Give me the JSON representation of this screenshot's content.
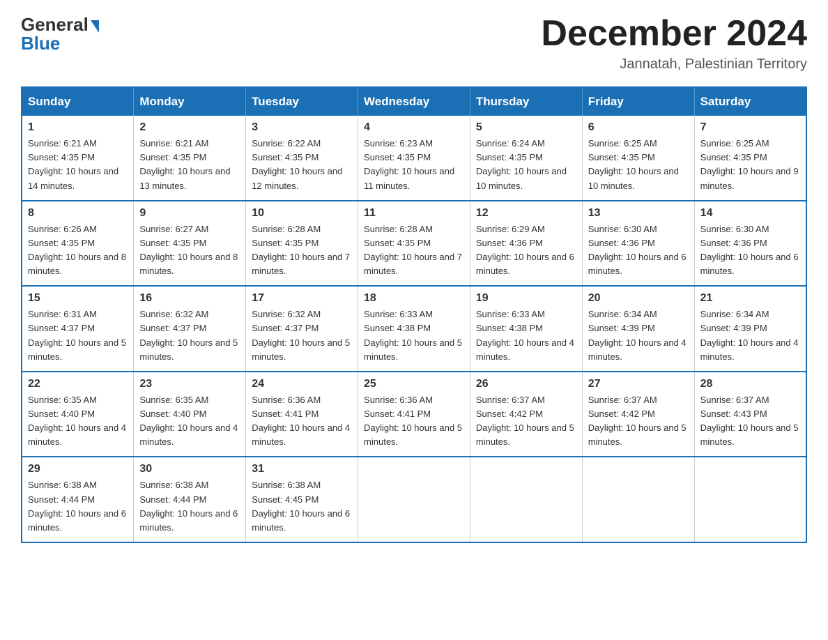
{
  "logo": {
    "general": "General",
    "blue": "Blue"
  },
  "header": {
    "month": "December 2024",
    "location": "Jannatah, Palestinian Territory"
  },
  "days_of_week": [
    "Sunday",
    "Monday",
    "Tuesday",
    "Wednesday",
    "Thursday",
    "Friday",
    "Saturday"
  ],
  "weeks": [
    [
      {
        "day": "1",
        "sunrise": "6:21 AM",
        "sunset": "4:35 PM",
        "daylight": "10 hours and 14 minutes."
      },
      {
        "day": "2",
        "sunrise": "6:21 AM",
        "sunset": "4:35 PM",
        "daylight": "10 hours and 13 minutes."
      },
      {
        "day": "3",
        "sunrise": "6:22 AM",
        "sunset": "4:35 PM",
        "daylight": "10 hours and 12 minutes."
      },
      {
        "day": "4",
        "sunrise": "6:23 AM",
        "sunset": "4:35 PM",
        "daylight": "10 hours and 11 minutes."
      },
      {
        "day": "5",
        "sunrise": "6:24 AM",
        "sunset": "4:35 PM",
        "daylight": "10 hours and 10 minutes."
      },
      {
        "day": "6",
        "sunrise": "6:25 AM",
        "sunset": "4:35 PM",
        "daylight": "10 hours and 10 minutes."
      },
      {
        "day": "7",
        "sunrise": "6:25 AM",
        "sunset": "4:35 PM",
        "daylight": "10 hours and 9 minutes."
      }
    ],
    [
      {
        "day": "8",
        "sunrise": "6:26 AM",
        "sunset": "4:35 PM",
        "daylight": "10 hours and 8 minutes."
      },
      {
        "day": "9",
        "sunrise": "6:27 AM",
        "sunset": "4:35 PM",
        "daylight": "10 hours and 8 minutes."
      },
      {
        "day": "10",
        "sunrise": "6:28 AM",
        "sunset": "4:35 PM",
        "daylight": "10 hours and 7 minutes."
      },
      {
        "day": "11",
        "sunrise": "6:28 AM",
        "sunset": "4:35 PM",
        "daylight": "10 hours and 7 minutes."
      },
      {
        "day": "12",
        "sunrise": "6:29 AM",
        "sunset": "4:36 PM",
        "daylight": "10 hours and 6 minutes."
      },
      {
        "day": "13",
        "sunrise": "6:30 AM",
        "sunset": "4:36 PM",
        "daylight": "10 hours and 6 minutes."
      },
      {
        "day": "14",
        "sunrise": "6:30 AM",
        "sunset": "4:36 PM",
        "daylight": "10 hours and 6 minutes."
      }
    ],
    [
      {
        "day": "15",
        "sunrise": "6:31 AM",
        "sunset": "4:37 PM",
        "daylight": "10 hours and 5 minutes."
      },
      {
        "day": "16",
        "sunrise": "6:32 AM",
        "sunset": "4:37 PM",
        "daylight": "10 hours and 5 minutes."
      },
      {
        "day": "17",
        "sunrise": "6:32 AM",
        "sunset": "4:37 PM",
        "daylight": "10 hours and 5 minutes."
      },
      {
        "day": "18",
        "sunrise": "6:33 AM",
        "sunset": "4:38 PM",
        "daylight": "10 hours and 5 minutes."
      },
      {
        "day": "19",
        "sunrise": "6:33 AM",
        "sunset": "4:38 PM",
        "daylight": "10 hours and 4 minutes."
      },
      {
        "day": "20",
        "sunrise": "6:34 AM",
        "sunset": "4:39 PM",
        "daylight": "10 hours and 4 minutes."
      },
      {
        "day": "21",
        "sunrise": "6:34 AM",
        "sunset": "4:39 PM",
        "daylight": "10 hours and 4 minutes."
      }
    ],
    [
      {
        "day": "22",
        "sunrise": "6:35 AM",
        "sunset": "4:40 PM",
        "daylight": "10 hours and 4 minutes."
      },
      {
        "day": "23",
        "sunrise": "6:35 AM",
        "sunset": "4:40 PM",
        "daylight": "10 hours and 4 minutes."
      },
      {
        "day": "24",
        "sunrise": "6:36 AM",
        "sunset": "4:41 PM",
        "daylight": "10 hours and 4 minutes."
      },
      {
        "day": "25",
        "sunrise": "6:36 AM",
        "sunset": "4:41 PM",
        "daylight": "10 hours and 5 minutes."
      },
      {
        "day": "26",
        "sunrise": "6:37 AM",
        "sunset": "4:42 PM",
        "daylight": "10 hours and 5 minutes."
      },
      {
        "day": "27",
        "sunrise": "6:37 AM",
        "sunset": "4:42 PM",
        "daylight": "10 hours and 5 minutes."
      },
      {
        "day": "28",
        "sunrise": "6:37 AM",
        "sunset": "4:43 PM",
        "daylight": "10 hours and 5 minutes."
      }
    ],
    [
      {
        "day": "29",
        "sunrise": "6:38 AM",
        "sunset": "4:44 PM",
        "daylight": "10 hours and 6 minutes."
      },
      {
        "day": "30",
        "sunrise": "6:38 AM",
        "sunset": "4:44 PM",
        "daylight": "10 hours and 6 minutes."
      },
      {
        "day": "31",
        "sunrise": "6:38 AM",
        "sunset": "4:45 PM",
        "daylight": "10 hours and 6 minutes."
      },
      null,
      null,
      null,
      null
    ]
  ]
}
